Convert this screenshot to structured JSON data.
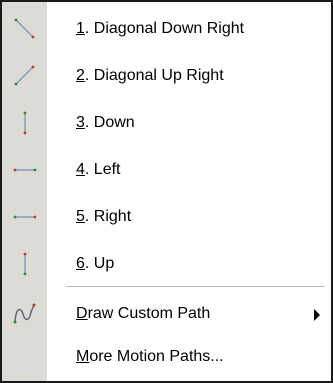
{
  "menu": {
    "items": [
      {
        "mnemonic": "1",
        "label": ". Diagonal Down Right",
        "icon": "diagonal-down-right-icon"
      },
      {
        "mnemonic": "2",
        "label": ". Diagonal Up Right",
        "icon": "diagonal-up-right-icon"
      },
      {
        "mnemonic": "3",
        "label": ". Down",
        "icon": "down-icon"
      },
      {
        "mnemonic": "4",
        "label": ". Left",
        "icon": "left-icon"
      },
      {
        "mnemonic": "5",
        "label": ". Right",
        "icon": "right-icon"
      },
      {
        "mnemonic": "6",
        "label": ". Up",
        "icon": "up-icon"
      }
    ],
    "custom_path": {
      "mnemonic": "D",
      "label": "raw Custom Path",
      "icon": "custom-path-icon",
      "has_submenu": true
    },
    "more_paths": {
      "mnemonic": "M",
      "label": "ore Motion Paths..."
    }
  },
  "colors": {
    "icon_strip": "#dddbd5",
    "path_line": "#7f9db9",
    "start_dot": "#2e8b2e",
    "end_dot": "#c0392b"
  }
}
